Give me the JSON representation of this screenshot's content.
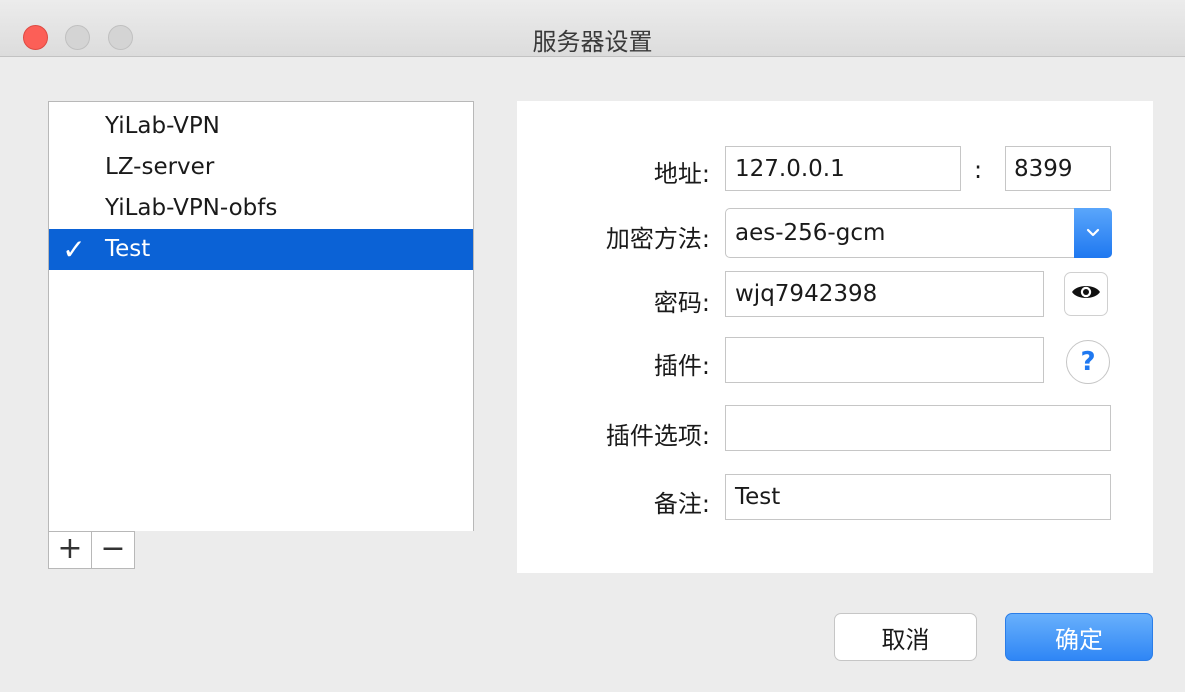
{
  "window": {
    "title": "服务器设置"
  },
  "server_list": {
    "items": [
      {
        "label": "YiLab-VPN",
        "selected": false
      },
      {
        "label": "LZ-server",
        "selected": false
      },
      {
        "label": "YiLab-VPN-obfs",
        "selected": false
      },
      {
        "label": "Test",
        "selected": true
      }
    ],
    "check_glyph": "✓",
    "add_label": "+",
    "remove_label": "−"
  },
  "form": {
    "address_label": "地址:",
    "address_value": "127.0.0.1",
    "port_separator": ":",
    "port_value": "8399",
    "encryption_label": "加密方法:",
    "encryption_value": "aes-256-gcm",
    "password_label": "密码:",
    "password_value": "wjq7942398",
    "plugin_label": "插件:",
    "plugin_value": "",
    "plugin_options_label": "插件选项:",
    "plugin_options_value": "",
    "remark_label": "备注:",
    "remark_value": "Test",
    "help_glyph": "?"
  },
  "buttons": {
    "cancel_label": "取消",
    "ok_label": "确定"
  },
  "icons": {
    "password_toggle": "eye-icon",
    "select_arrow": "chevron-down-icon",
    "help": "question-icon"
  },
  "colors": {
    "selection": "#0b62d6",
    "accent": "#1f78f0",
    "close_button": "#fc5f57"
  }
}
